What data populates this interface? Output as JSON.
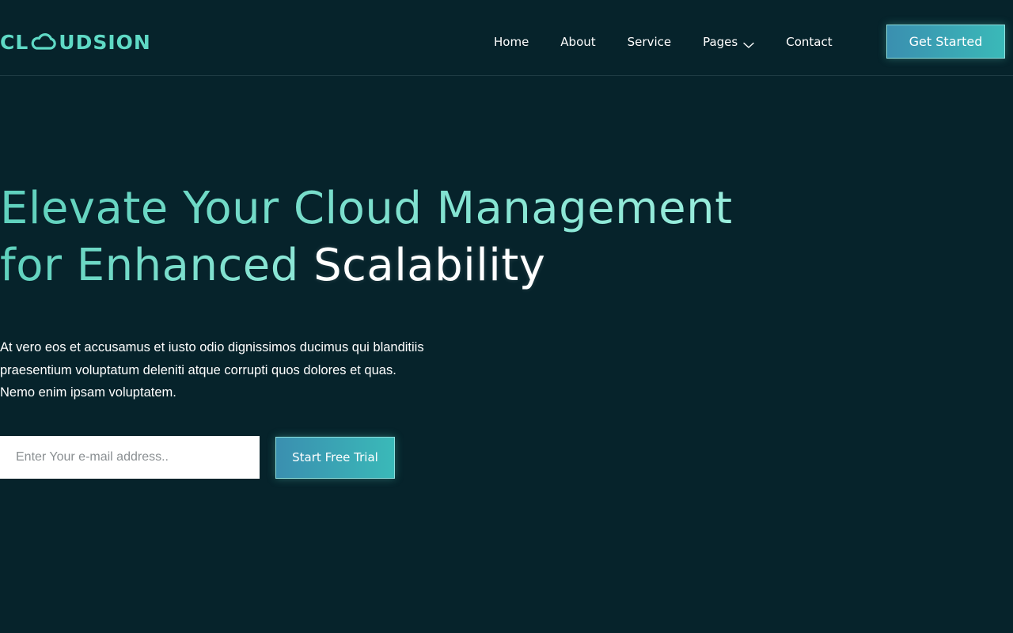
{
  "brand": {
    "name_prefix": "CL",
    "name_suffix": "UDSION",
    "logo_icon": "cloud-icon",
    "accent_color": "#5fd9c5"
  },
  "nav": {
    "items": [
      {
        "label": "Home"
      },
      {
        "label": "About"
      },
      {
        "label": "Service"
      },
      {
        "label": "Pages",
        "icon": "chevron-down-icon"
      },
      {
        "label": "Contact"
      }
    ],
    "cta_label": "Get Started"
  },
  "hero": {
    "title_line1": "Elevate Your Cloud Management",
    "title_line2_start": "for Enhanced ",
    "title_highlight": "Scalability",
    "description_lines": [
      "At vero eos et accusamus et iusto odio dignissimos ducimus qui blanditiis",
      "praesentium voluptatum deleniti atque corrupti quos dolores et quas.",
      "Nemo enim ipsam voluptatem."
    ],
    "email_placeholder": "Enter Your e-mail address..",
    "email_value": "",
    "trial_label": "Start Free Trial"
  },
  "colors": {
    "background": "#06232b",
    "title_gradient_start": "#5fd1bd",
    "title_gradient_end": "#9ef0e0",
    "button_gradient_start": "#3a8fb0",
    "button_gradient_end": "#3ab9b8"
  }
}
